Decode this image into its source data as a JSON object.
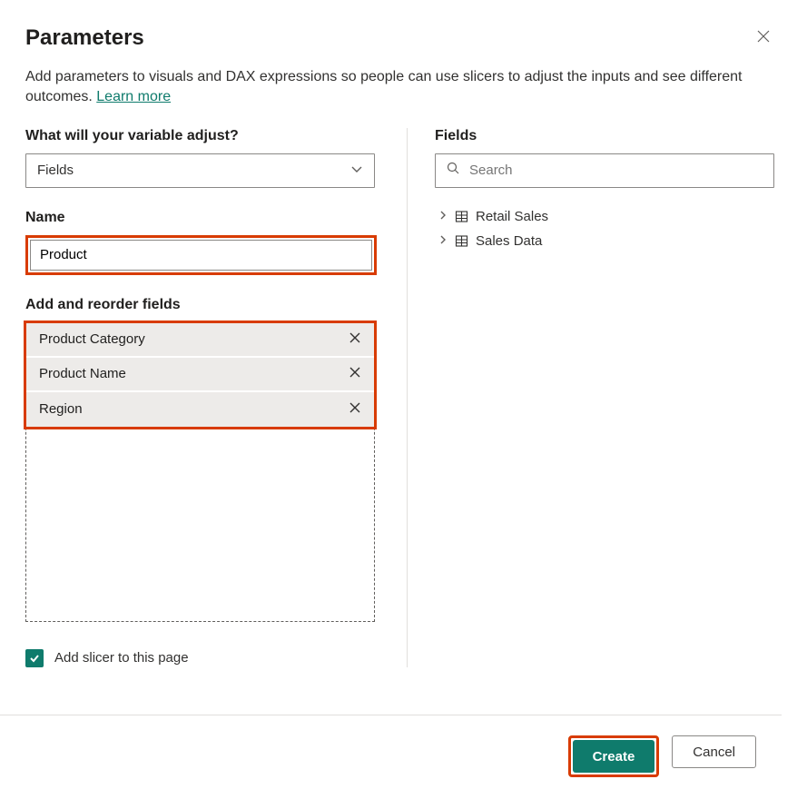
{
  "dialog": {
    "title": "Parameters",
    "description_part1": "Add parameters to visuals and DAX expressions so people can use slicers to adjust the inputs and see different outcomes. ",
    "learn_more": "Learn more"
  },
  "variable_section": {
    "label": "What will your variable adjust?",
    "value": "Fields"
  },
  "name_section": {
    "label": "Name",
    "value": "Product"
  },
  "reorder_section": {
    "label": "Add and reorder fields",
    "items": [
      "Product Category",
      "Product Name",
      "Region"
    ]
  },
  "slicer_checkbox": {
    "label": "Add slicer to this page",
    "checked": true
  },
  "fields_panel": {
    "label": "Fields",
    "search_placeholder": "Search",
    "tables": [
      "Retail Sales",
      "Sales Data"
    ]
  },
  "footer": {
    "create": "Create",
    "cancel": "Cancel"
  }
}
